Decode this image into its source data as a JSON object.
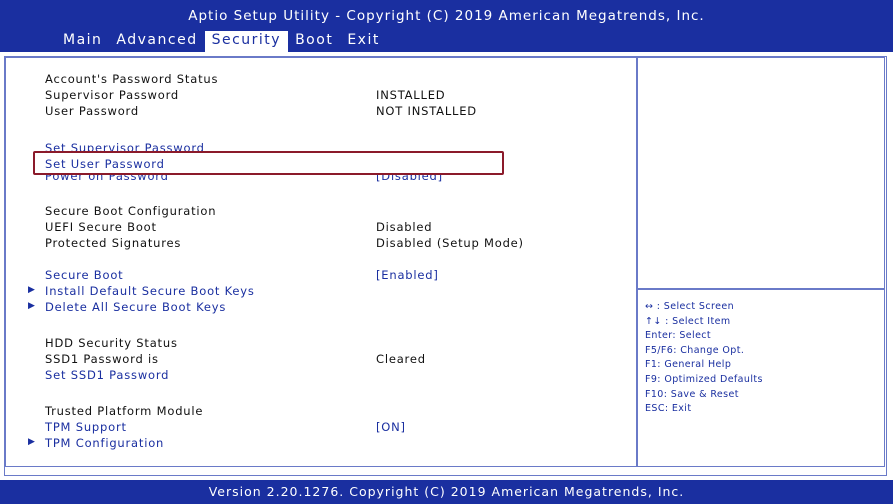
{
  "header": {
    "title": "Aptio Setup Utility - Copyright (C) 2019 American Megatrends, Inc.",
    "menu": [
      "Main",
      "Advanced",
      "Security",
      "Boot",
      "Exit"
    ],
    "active_menu": "Security"
  },
  "main": {
    "account_status_heading": "Account's Password Status",
    "supervisor_password_label": "Supervisor Password",
    "supervisor_password_value": "INSTALLED",
    "user_password_label": "User Password",
    "user_password_value": "NOT INSTALLED",
    "set_supervisor_password": "Set Supervisor Password",
    "set_user_password": "Set User Password",
    "power_on_password_label": "Power on Password",
    "power_on_password_value": "[Disabled]",
    "secure_boot_config_heading": "Secure Boot Configuration",
    "uefi_secure_boot_label": "UEFI Secure Boot",
    "uefi_secure_boot_value": "Disabled",
    "protected_signatures_label": "Protected Signatures",
    "protected_signatures_value": "Disabled (Setup Mode)",
    "secure_boot_label": "Secure Boot",
    "secure_boot_value": "[Enabled]",
    "install_default_keys": "Install Default Secure Boot Keys",
    "delete_all_keys": "Delete All Secure Boot Keys",
    "hdd_security_heading": "HDD Security Status",
    "ssd1_password_label": "SSD1 Password is",
    "ssd1_password_value": "Cleared",
    "set_ssd1_password": "Set SSD1 Password",
    "tpm_heading": "Trusted Platform Module",
    "tpm_support_label": "TPM Support",
    "tpm_support_value": "[ON]",
    "tpm_configuration": "TPM Configuration",
    "submenu_arrow": "▶"
  },
  "help": [
    "↔ : Select Screen",
    "↑↓ : Select Item",
    "Enter: Select",
    "F5/F6: Change Opt.",
    "F1: General Help",
    "F9: Optimized Defaults",
    "F10: Save & Reset",
    "ESC: Exit"
  ],
  "footer": "Version 2.20.1276. Copyright (C) 2019 American Megatrends, Inc.",
  "colors": {
    "bios_blue": "#1a2fa0",
    "selection_border": "#8b1a2a",
    "panel_bg": "#ffffff"
  }
}
